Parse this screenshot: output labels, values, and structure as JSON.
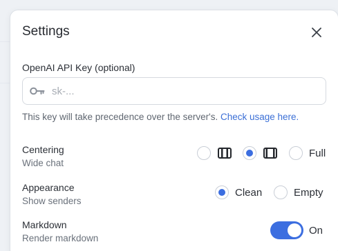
{
  "dialog": {
    "title": "Settings",
    "close_icon": "close-icon"
  },
  "api_key": {
    "label": "OpenAI API Key (optional)",
    "placeholder": "sk-...",
    "value": "",
    "icon": "key-icon",
    "helper_text": "This key will take precedence over the server's.",
    "helper_link": "Check usage here."
  },
  "centering": {
    "label": "Centering",
    "sublabel": "Wide chat",
    "options": [
      {
        "icon": "narrow-width-icon",
        "selected": false
      },
      {
        "icon": "medium-width-icon",
        "selected": true
      },
      {
        "label": "Full",
        "selected": false
      }
    ]
  },
  "appearance": {
    "label": "Appearance",
    "sublabel": "Show senders",
    "options": [
      {
        "label": "Clean",
        "selected": true
      },
      {
        "label": "Empty",
        "selected": false
      }
    ]
  },
  "markdown": {
    "label": "Markdown",
    "sublabel": "Render markdown",
    "toggle_on": true,
    "toggle_label": "On"
  },
  "colors": {
    "accent": "#3c6ee0",
    "link": "#3b6fd6"
  }
}
